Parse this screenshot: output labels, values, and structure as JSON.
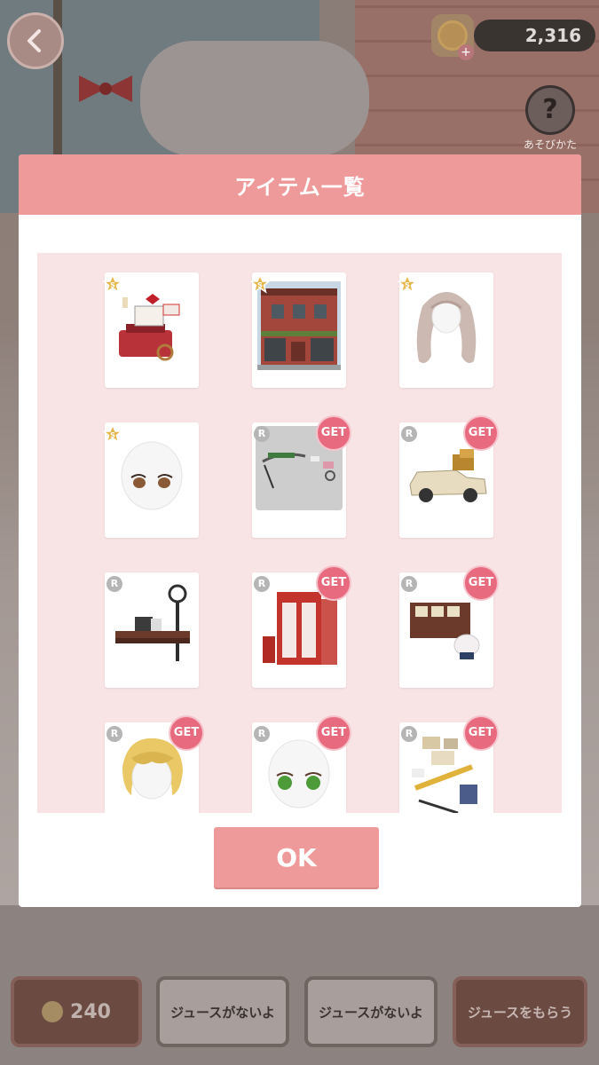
{
  "hud": {
    "coins": "2,316",
    "help_label": "あそびかた"
  },
  "modal": {
    "title": "アイテム一覧",
    "ok_label": "OK",
    "items": [
      {
        "name": "typewriter-set",
        "rarity": "S",
        "get": false
      },
      {
        "name": "brick-building",
        "rarity": "S",
        "get": false
      },
      {
        "name": "long-wavy-hair",
        "rarity": "S",
        "get": false
      },
      {
        "name": "brown-eyes-face",
        "rarity": "S",
        "get": false
      },
      {
        "name": "clue-string-wall",
        "rarity": "R",
        "get": true
      },
      {
        "name": "cream-car",
        "rarity": "R",
        "get": true
      },
      {
        "name": "clock-bench",
        "rarity": "R",
        "get": true
      },
      {
        "name": "red-phone-booth",
        "rarity": "R",
        "get": true
      },
      {
        "name": "newspaper-stand",
        "rarity": "R",
        "get": true
      },
      {
        "name": "blonde-hair",
        "rarity": "R",
        "get": true
      },
      {
        "name": "green-eyes-face",
        "rarity": "R",
        "get": true
      },
      {
        "name": "evidence-board",
        "rarity": "R",
        "get": true
      }
    ],
    "get_label": "GET"
  },
  "bottom": {
    "coin_value": "240",
    "btn2": "ジュースがないよ",
    "btn3": "ジュースがないよ",
    "btn4": "ジュースをもらう"
  }
}
